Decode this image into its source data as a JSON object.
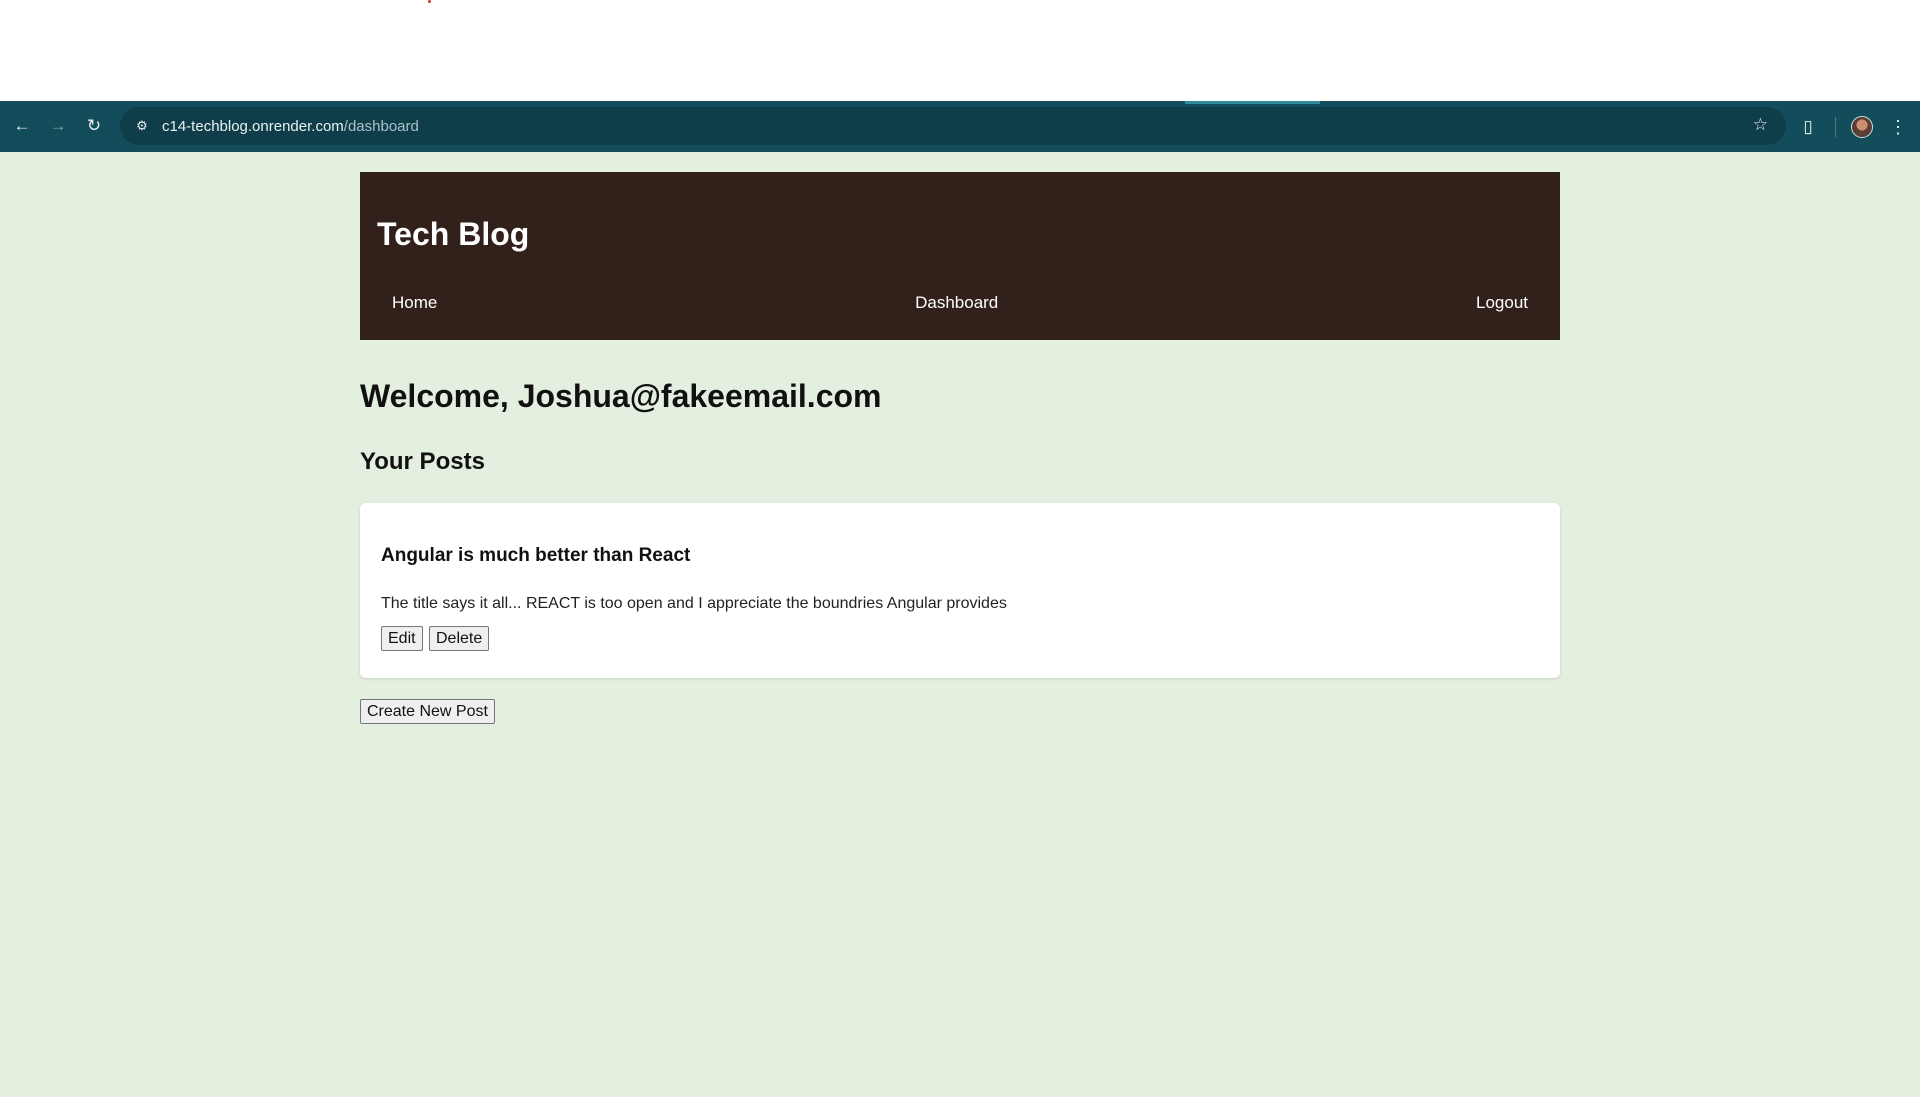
{
  "browser": {
    "url_domain": "c14-techblog.onrender.com",
    "url_path": "/dashboard"
  },
  "site": {
    "title": "Tech Blog",
    "nav": [
      "Home",
      "Dashboard",
      "Logout"
    ]
  },
  "dashboard": {
    "welcome": "Welcome, Joshua@fakeemail.com",
    "posts_heading": "Your Posts",
    "create_label": "Create New Post"
  },
  "posts": [
    {
      "title": "Angular is much better than React",
      "body": "The title says it all... REACT is too open and I appreciate the boundries Angular provides",
      "edit_label": "Edit",
      "delete_label": "Delete"
    }
  ],
  "colors": {
    "browser_bar": "#134c5a",
    "header_bg": "#32211a",
    "page_bg": "#e3efdf"
  }
}
